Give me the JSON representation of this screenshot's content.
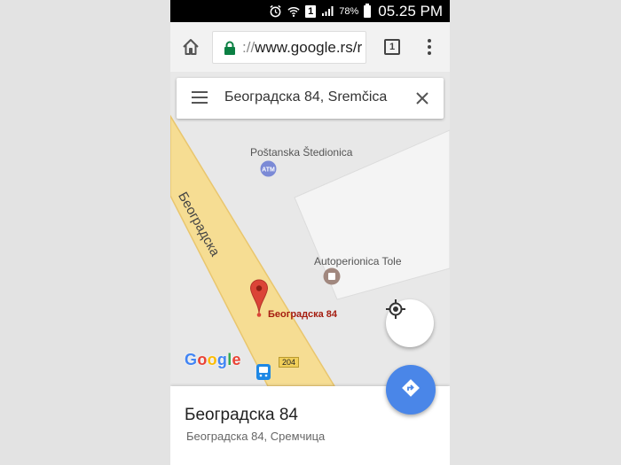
{
  "status_bar": {
    "battery": "78%",
    "sim": "1",
    "time": "05.25 PM",
    "icons": [
      "alarm-icon",
      "wifi-icon",
      "sim-icon",
      "signal-icon",
      "battery-icon"
    ]
  },
  "browser": {
    "url_prefix": "://",
    "url_host": "www.google.rs/r",
    "tab_count": "1",
    "icons": [
      "home-icon",
      "lock-icon",
      "tabs-icon",
      "overflow-menu-icon"
    ]
  },
  "search": {
    "query": "Београдска 84, Sremčica",
    "icons": [
      "hamburger-icon",
      "close-icon"
    ]
  },
  "map": {
    "street_name": "Београдска",
    "pois": [
      {
        "name": "Poštanska Štedionica",
        "icon": "atm-icon"
      },
      {
        "name": "Autoperionica Tole",
        "icon": "car-wash-icon"
      }
    ],
    "pin_label": "Београдска 84",
    "route_badge": "204",
    "logo": "Google",
    "colors": {
      "road": "#f6dd93",
      "road_edge": "#e9c66e",
      "pin": "#db4437",
      "directions": "#4a86e8"
    }
  },
  "place": {
    "title": "Београдска 84",
    "address": "Београдска 84, Сремчица"
  }
}
